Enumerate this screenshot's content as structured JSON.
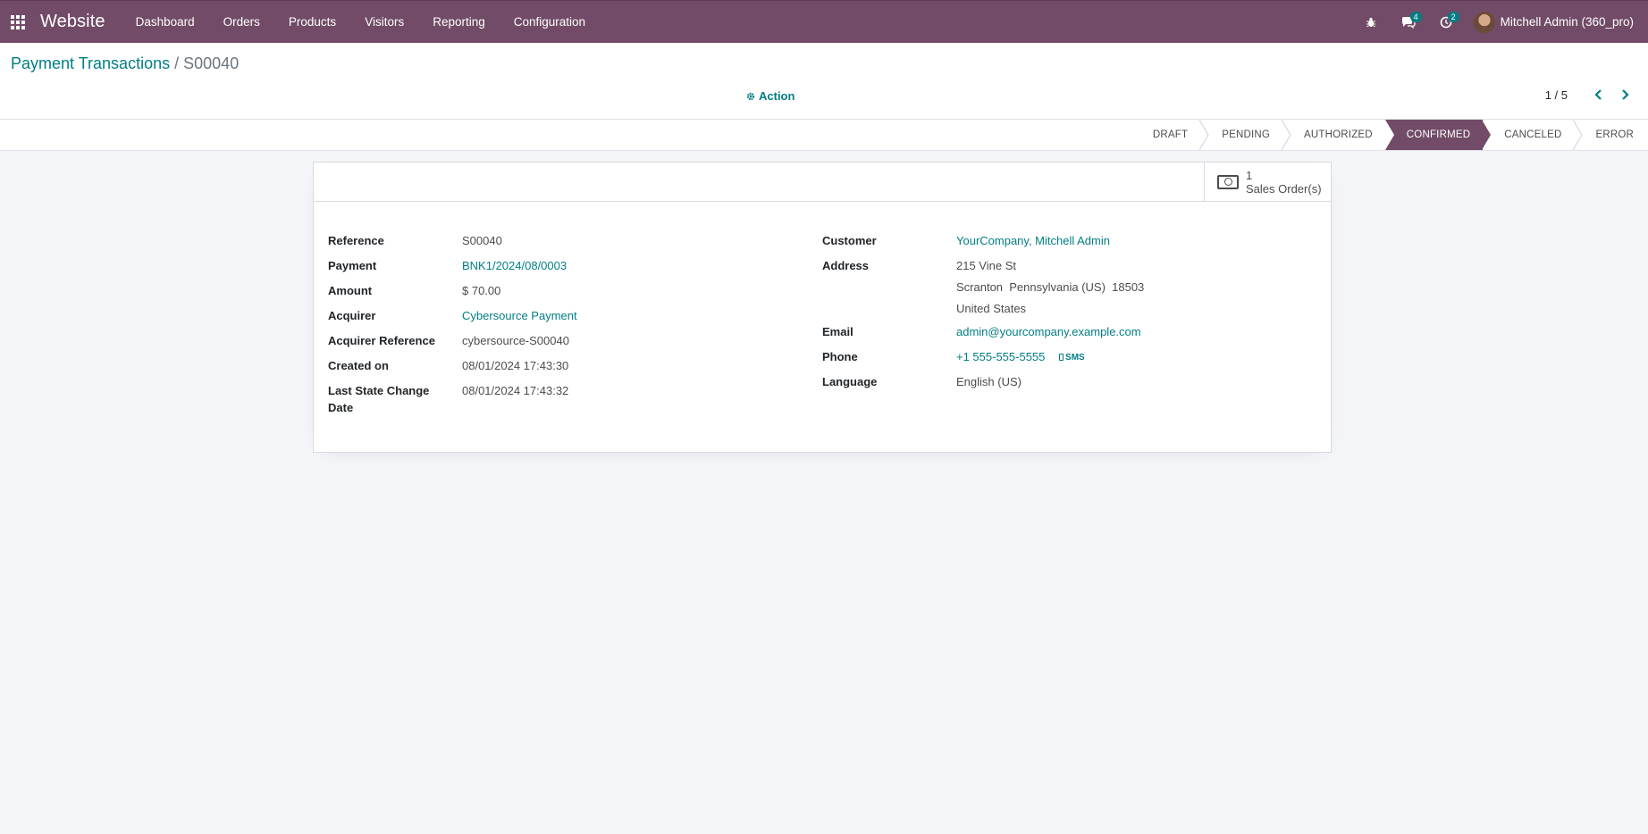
{
  "navbar": {
    "app_name": "Website",
    "menu": [
      "Dashboard",
      "Orders",
      "Products",
      "Visitors",
      "Reporting",
      "Configuration"
    ],
    "messages_count": "4",
    "activities_count": "2",
    "user": "Mitchell Admin (360_pro)"
  },
  "breadcrumb": {
    "parent": "Payment Transactions",
    "separator": "/",
    "current": "S00040"
  },
  "action_label": "Action",
  "pager": {
    "value": "1 / 5"
  },
  "statusbar": {
    "steps": [
      "DRAFT",
      "PENDING",
      "AUTHORIZED",
      "CONFIRMED",
      "CANCELED",
      "ERROR"
    ],
    "active": "CONFIRMED"
  },
  "smart_button": {
    "count": "1",
    "label": "Sales Order(s)"
  },
  "left_fields": {
    "reference": {
      "label": "Reference",
      "value": "S00040"
    },
    "payment": {
      "label": "Payment",
      "value": "BNK1/2024/08/0003"
    },
    "amount": {
      "label": "Amount",
      "value": "$ 70.00"
    },
    "acquirer": {
      "label": "Acquirer",
      "value": "Cybersource Payment"
    },
    "acquirer_reference": {
      "label": "Acquirer Reference",
      "value": "cybersource-S00040"
    },
    "created_on": {
      "label": "Created on",
      "value": "08/01/2024 17:43:30"
    },
    "last_state_change_line1": "Last State Change",
    "last_state_change_line2": "Date",
    "last_state_change_value": "08/01/2024 17:43:32"
  },
  "right_fields": {
    "customer": {
      "label": "Customer",
      "value": "YourCompany, Mitchell Admin"
    },
    "address": {
      "label": "Address",
      "street": "215 Vine St",
      "city_line": "Scranton  Pennsylvania (US)  18503",
      "country": "United States"
    },
    "email": {
      "label": "Email",
      "value": "admin@yourcompany.example.com"
    },
    "phone": {
      "label": "Phone",
      "value": "+1 555-555-5555",
      "sms": "SMS"
    },
    "language": {
      "label": "Language",
      "value": "English (US)"
    }
  },
  "colors": {
    "brand": "#714b67",
    "link": "#017e84",
    "background": "#f4f5f8"
  },
  "icons": [
    "apps-grid-icon",
    "bug-icon",
    "chat-icon",
    "clock-icon",
    "gear-icon",
    "chevron-left-icon",
    "chevron-right-icon",
    "money-icon",
    "mobile-icon"
  ]
}
